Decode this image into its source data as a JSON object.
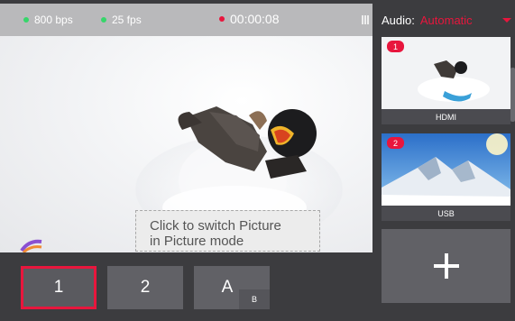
{
  "status": {
    "bitrate": "800 bps",
    "framerate": "25 fps",
    "timer": "00:00:08"
  },
  "tooltip": {
    "line1": "Click to switch Picture",
    "line2": "in Picture mode"
  },
  "layouts": {
    "btn1": "1",
    "btn2": "2",
    "btnA": "A",
    "btnA_sub": "B"
  },
  "audio": {
    "label": "Audio:",
    "value": "Automatic"
  },
  "sources": [
    {
      "badge": "1",
      "label": "HDMI"
    },
    {
      "badge": "2",
      "label": "USB"
    }
  ],
  "colors": {
    "accent": "#e8163d",
    "live": "#36d66a"
  }
}
